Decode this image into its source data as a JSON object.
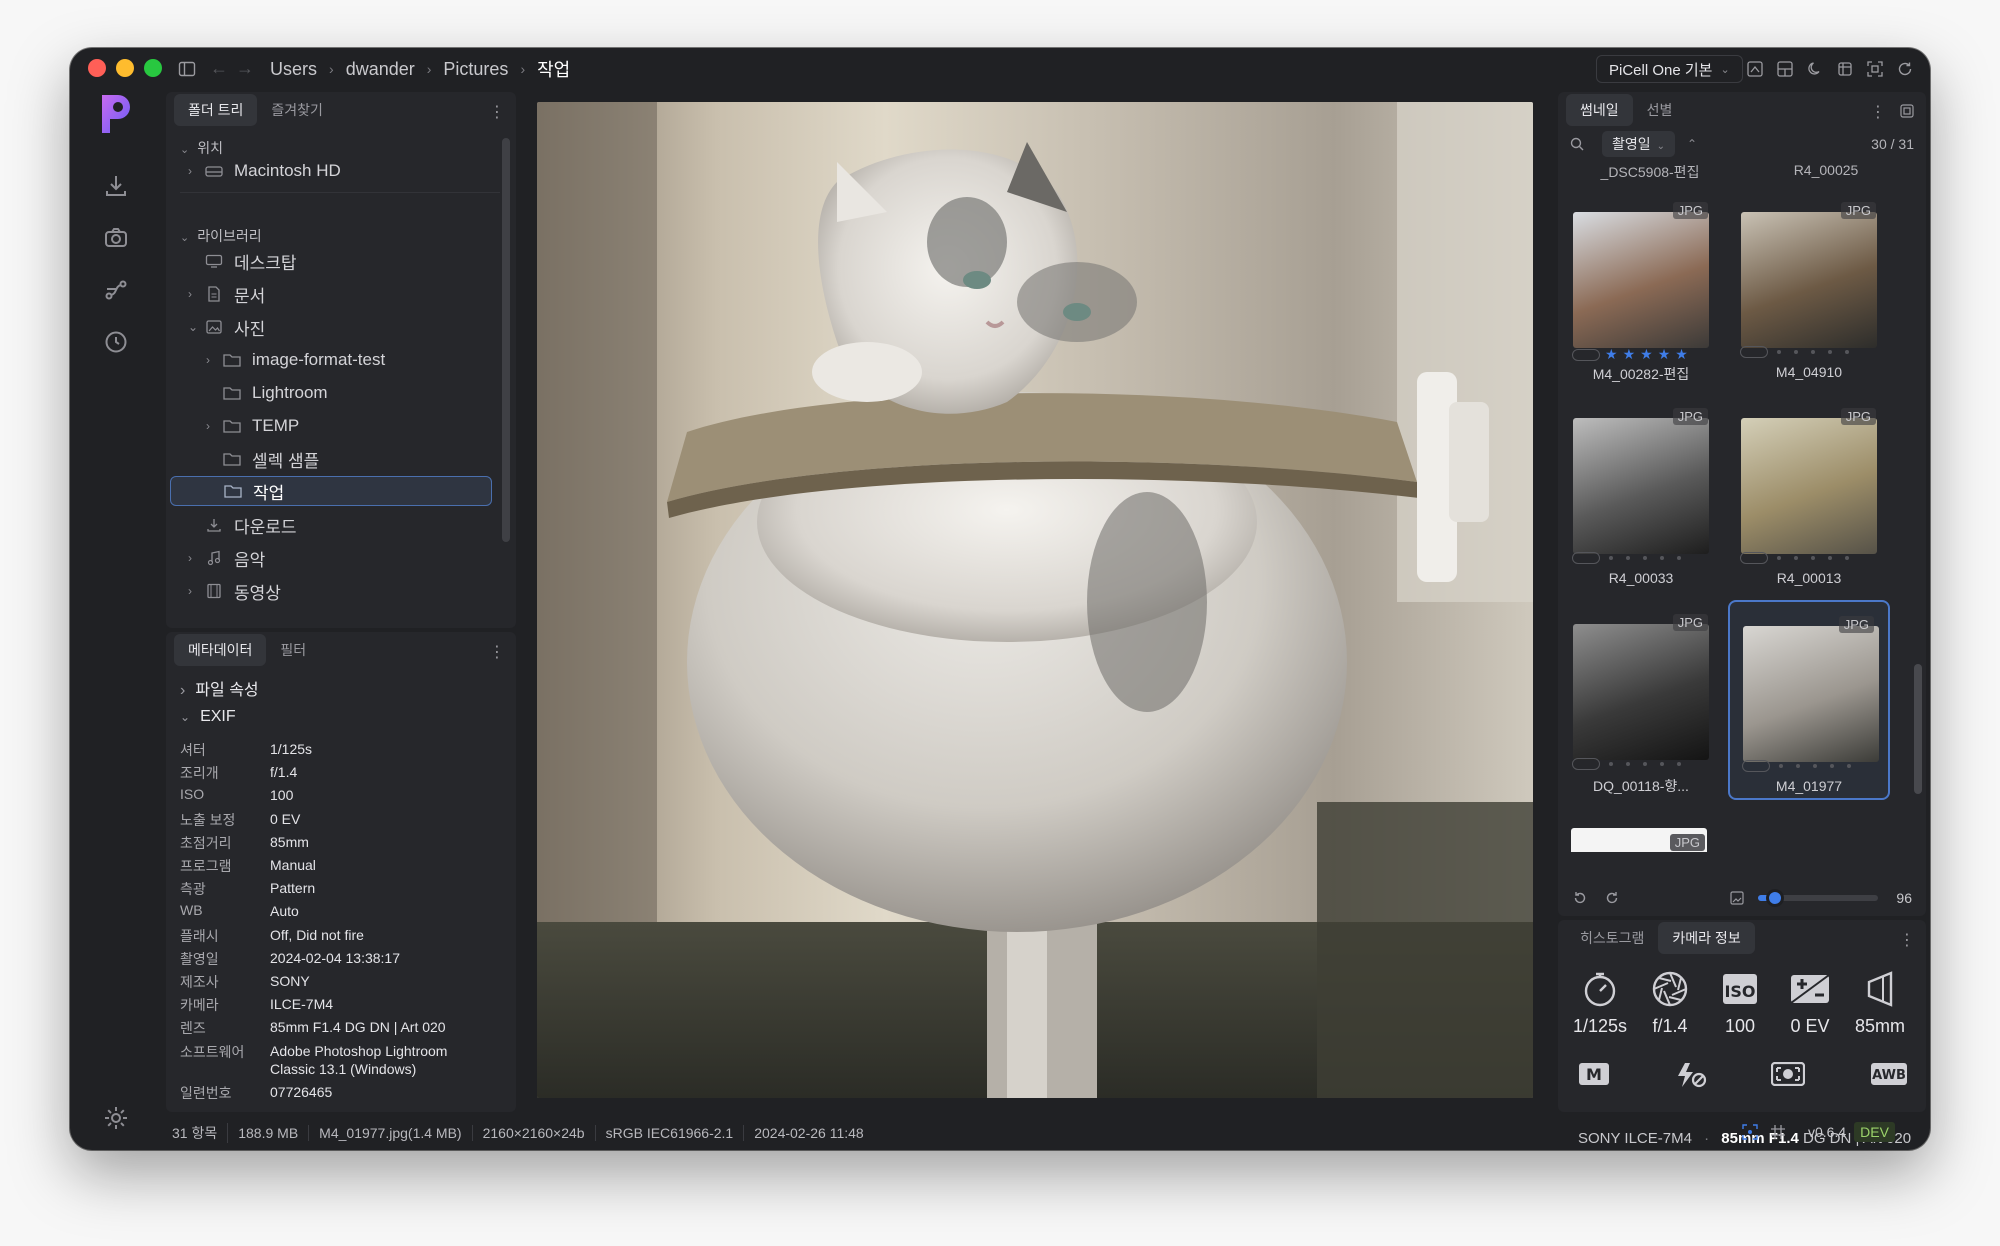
{
  "titlebar": {
    "breadcrumb": [
      "Users",
      "dwander",
      "Pictures",
      "작업"
    ],
    "preset_label": "PiCell One 기본"
  },
  "folder_panel": {
    "tabs": [
      "폴더 트리",
      "즐겨찾기"
    ],
    "location_header": "위치",
    "location_items": [
      "Macintosh HD"
    ],
    "library_header": "라이브러리",
    "library_items": {
      "desktop": "데스크탑",
      "documents": "문서",
      "photos": "사진",
      "image_format_test": "image-format-test",
      "lightroom": "Lightroom",
      "temp": "TEMP",
      "select_sample": "셀렉 샘플",
      "work": "작업",
      "downloads": "다운로드",
      "music": "음악",
      "videos": "동영상"
    }
  },
  "meta_panel": {
    "tabs": [
      "메타데이터",
      "필터"
    ],
    "file_props": "파일 속성",
    "exif": "EXIF",
    "rows": [
      {
        "k": "셔터",
        "v": "1/125s"
      },
      {
        "k": "조리개",
        "v": "f/1.4"
      },
      {
        "k": "ISO",
        "v": "100"
      },
      {
        "k": "노출 보정",
        "v": "0 EV"
      },
      {
        "k": "초점거리",
        "v": "85mm"
      },
      {
        "k": "프로그램",
        "v": "Manual"
      },
      {
        "k": "측광",
        "v": "Pattern"
      },
      {
        "k": "WB",
        "v": "Auto"
      },
      {
        "k": "플래시",
        "v": "Off, Did not fire"
      },
      {
        "k": "촬영일",
        "v": "2024-02-04 13:38:17"
      },
      {
        "k": "제조사",
        "v": "SONY"
      },
      {
        "k": "카메라",
        "v": "ILCE-7M4"
      },
      {
        "k": "렌즈",
        "v": "85mm F1.4 DG DN | Art 020"
      },
      {
        "k": "소프트웨어",
        "v": "Adobe Photoshop Lightroom Classic 13.1 (Windows)"
      },
      {
        "k": "일련번호",
        "v": "07726465"
      }
    ]
  },
  "thumb_panel": {
    "tabs": [
      "썸네일",
      "선별"
    ],
    "sort_label": "촬영일",
    "counter": "30 / 31",
    "top_names": [
      "_DSC5908-편집",
      "R4_00025"
    ],
    "items": [
      {
        "name": "M4_00282-편집",
        "badge": "JPG",
        "rating": 5
      },
      {
        "name": "M4_04910",
        "badge": "JPG",
        "rating": 0
      },
      {
        "name": "R4_00033",
        "badge": "JPG",
        "rating": 0
      },
      {
        "name": "R4_00013",
        "badge": "JPG",
        "rating": 0
      },
      {
        "name": "DQ_00118-향...",
        "badge": "JPG",
        "rating": 0
      },
      {
        "name": "M4_01977",
        "badge": "JPG",
        "rating": 0
      }
    ],
    "partial_badge": "JPG",
    "thumb_size": "96",
    "thumb_size_fraction": 0.12
  },
  "info_panel": {
    "tabs": [
      "히스토그램",
      "카메라 정보"
    ],
    "values": [
      "1/125s",
      "f/1.4",
      "100",
      "0 EV",
      "85mm"
    ],
    "icons": [
      "shutter-icon",
      "aperture-icon",
      "iso-icon",
      "exposure-comp-icon",
      "focal-length-icon"
    ],
    "mode_icons": [
      "manual-mode-icon",
      "flash-off-icon",
      "metering-icon",
      "awb-icon"
    ],
    "camera": "SONY ILCE-7M4",
    "lens_bold": "85mm F1.4",
    "lens_rest": "DG DN | Art 020"
  },
  "status_bar": {
    "items": [
      "31 항목",
      "188.9 MB",
      "M4_01977.jpg(1.4 MB)",
      "2160×2160×24b",
      "sRGB IEC61966-2.1",
      "2024-02-26 11:48"
    ],
    "version": "v0.6.4",
    "dev_badge": "DEV"
  },
  "colors": {
    "accent": "#4b78c9",
    "star": "#3f7de8",
    "dev": "#9bd36a"
  }
}
